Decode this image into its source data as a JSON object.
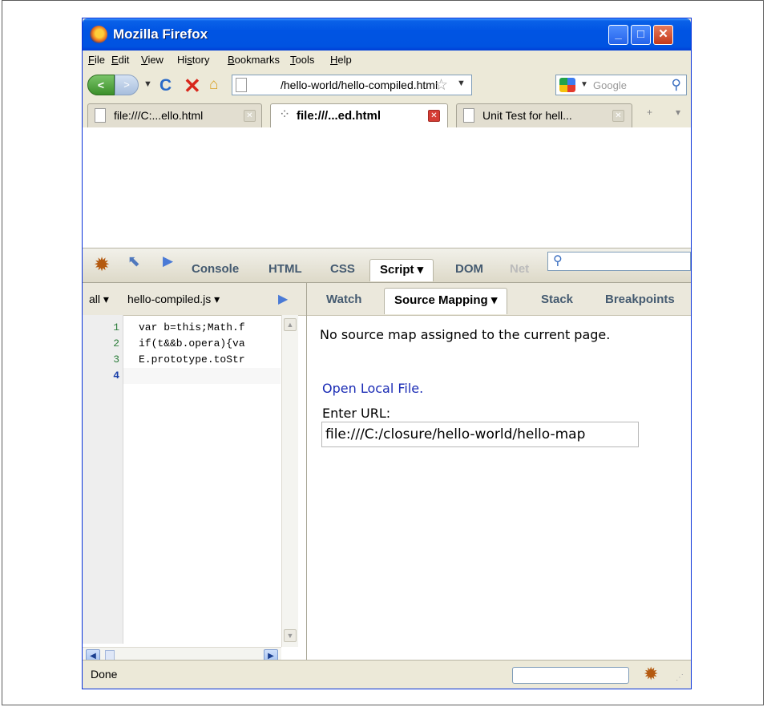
{
  "window": {
    "title": "Mozilla Firefox",
    "minimize": "_",
    "maximize": "□",
    "close": "✕"
  },
  "menu": [
    "File",
    "Edit",
    "View",
    "History",
    "Bookmarks",
    "Tools",
    "Help"
  ],
  "menu_mnemonics": [
    "F",
    "E",
    "V",
    "s",
    "B",
    "T",
    "H"
  ],
  "navbar": {
    "back": "<",
    "forward": ">",
    "url": "/hello-world/hello-compiled.html",
    "search_placeholder": "Google",
    "icons": [
      "back-icon",
      "forward-icon",
      "reload-icon",
      "stop-icon",
      "home-icon",
      "page-icon",
      "star-icon",
      "google-icon",
      "magnifier-icon"
    ]
  },
  "tabs": [
    {
      "label": "file:///C:...ello.html",
      "active": false
    },
    {
      "label": "file:///...ed.html",
      "active": true
    },
    {
      "label": "Unit Test for hell...",
      "active": false
    }
  ],
  "tab_controls": {
    "new_tab": "+",
    "list": "▾"
  },
  "firebug": {
    "panels": [
      "Console",
      "HTML",
      "CSS",
      "Script ▾",
      "DOM",
      "Net"
    ],
    "active_panel": "Script ▾",
    "disabled_panel": "Net",
    "script_toolbar": {
      "filter": "all ▾",
      "file": "hello-compiled.js ▾"
    },
    "code_lines": [
      {
        "no": "1",
        "text": "var b=this;Math.f"
      },
      {
        "no": "2",
        "text": "if(t&&b.opera){va"
      },
      {
        "no": "3",
        "text": "E.prototype.toStr"
      },
      {
        "no": "4",
        "text": ""
      }
    ],
    "side_tabs": [
      "Watch",
      "Source Mapping ▾",
      "Stack",
      "Breakpoints"
    ],
    "active_side_tab": "Source Mapping ▾",
    "source_mapping": {
      "message": "No source map assigned to the current page.",
      "open_link": "Open Local File.",
      "enter_label": "Enter URL:",
      "url_value": "file:///C:/closure/hello-world/hello-map"
    }
  },
  "status": {
    "text": "Done"
  },
  "colors": {
    "titlebar": "#0054e3",
    "chrome": "#ece9d8",
    "link": "#1a2bb5",
    "line_numbers": "#2e7e3c"
  }
}
